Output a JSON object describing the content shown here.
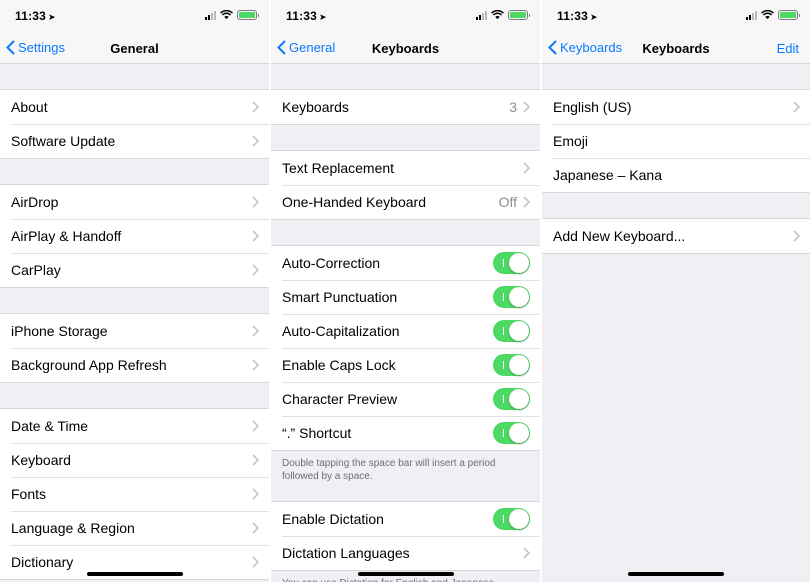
{
  "status": {
    "time": "11:33"
  },
  "screen1": {
    "back": "Settings",
    "title": "General",
    "groups": [
      [
        "About",
        "Software Update"
      ],
      [
        "AirDrop",
        "AirPlay & Handoff",
        "CarPlay"
      ],
      [
        "iPhone Storage",
        "Background App Refresh"
      ],
      [
        "Date & Time",
        "Keyboard",
        "Fonts",
        "Language & Region",
        "Dictionary"
      ]
    ]
  },
  "screen2": {
    "back": "General",
    "title": "Keyboards",
    "keyboards": {
      "label": "Keyboards",
      "value": "3"
    },
    "text_replacement": "Text Replacement",
    "one_handed": {
      "label": "One-Handed Keyboard",
      "value": "Off"
    },
    "toggles": [
      {
        "label": "Auto-Correction",
        "on": true
      },
      {
        "label": "Smart Punctuation",
        "on": true
      },
      {
        "label": "Auto-Capitalization",
        "on": true
      },
      {
        "label": "Enable Caps Lock",
        "on": true
      },
      {
        "label": "Character Preview",
        "on": true
      },
      {
        "label": "“.” Shortcut",
        "on": true
      }
    ],
    "shortcut_footer": "Double tapping the space bar will insert a period followed by a space.",
    "enable_dictation": {
      "label": "Enable Dictation",
      "on": true
    },
    "dictation_languages": "Dictation Languages",
    "dictation_footer": "You can use Dictation for English and Japanese"
  },
  "screen3": {
    "back": "Keyboards",
    "title": "Keyboards",
    "edit": "Edit",
    "keyboards": [
      "English (US)",
      "Emoji",
      "Japanese – Kana"
    ],
    "add_new": "Add New Keyboard..."
  },
  "colors": {
    "accent": "#0a7aff",
    "switch_on": "#4cd964",
    "background": "#efeff4"
  }
}
